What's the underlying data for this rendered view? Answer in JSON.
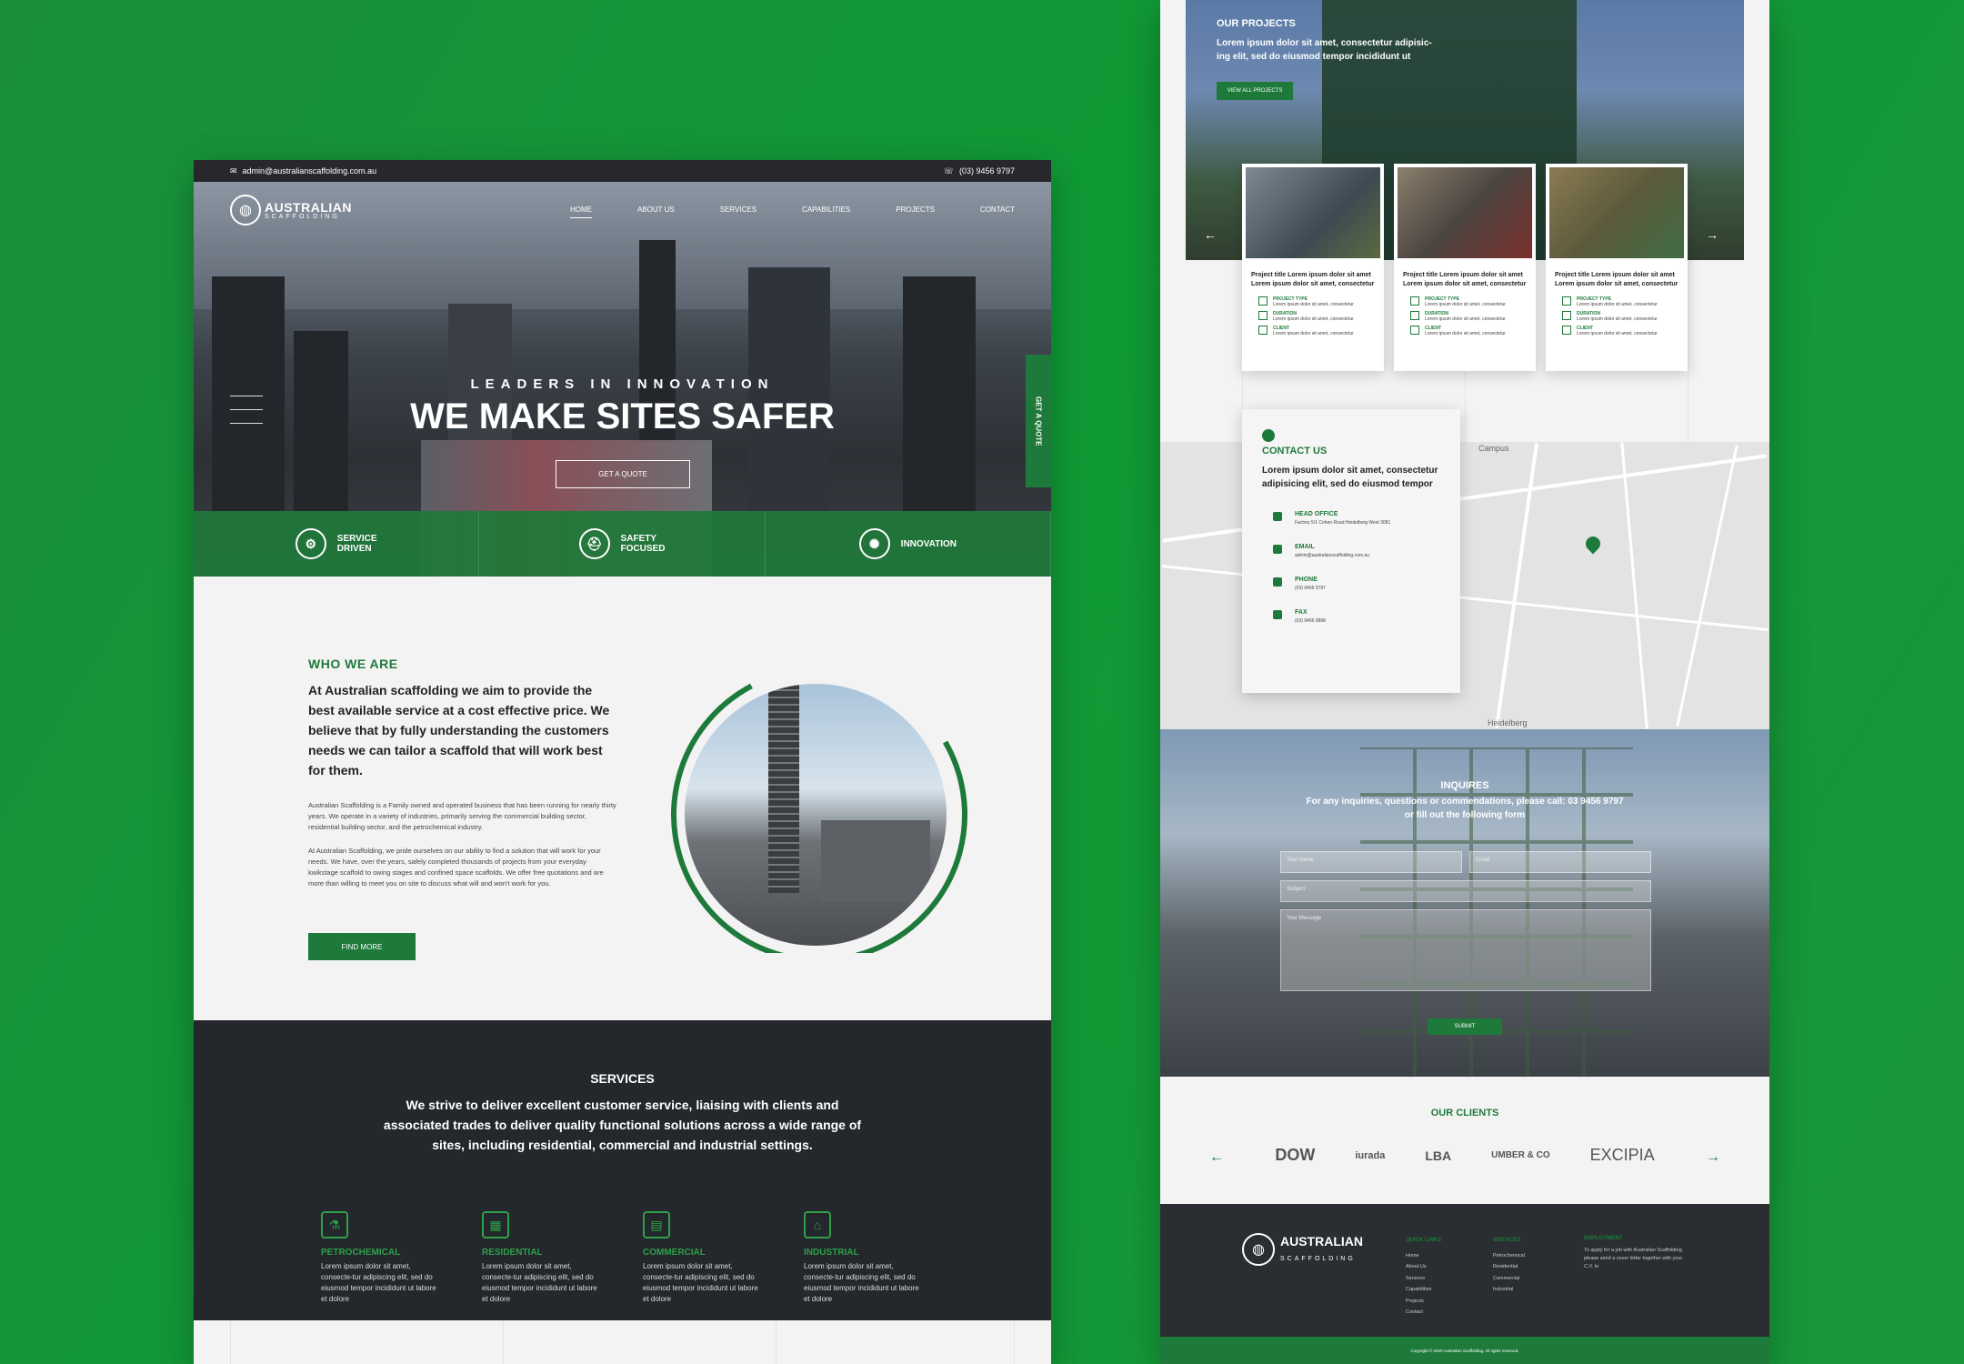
{
  "topbar": {
    "email": "admin@australianscaffolding.com.au",
    "phone": "(03) 9456 9797"
  },
  "brand": {
    "name": "AUSTRALIAN",
    "sub": "SCAFFOLDING"
  },
  "nav": [
    "HOME",
    "ABOUT US",
    "SERVICES",
    "CAPABILITIES",
    "PROJECTS",
    "CONTACT"
  ],
  "hero": {
    "tagline": "LEADERS IN INNOVATION",
    "title": "WE MAKE SITES SAFER",
    "button": "GET A QUOTE",
    "side_button": "GET A QUOTE"
  },
  "features": [
    {
      "label1": "SERVICE",
      "label2": "DRIVEN"
    },
    {
      "label1": "SAFETY",
      "label2": "FOCUSED"
    },
    {
      "label1": "INNOVATION",
      "label2": ""
    }
  ],
  "who": {
    "heading": "WHO WE ARE",
    "lead": "At Australian scaffolding we aim to provide the best available service at a cost effective price. We believe that by fully understanding the customers needs we can tailor a scaffold that will work best for them.",
    "p1": "Australian Scaffolding is a Family owned and operated business that has been running for nearly thirty years. We operate in a variety of industries, primarily serving the commercial building sector, residential building sector, and the petrochemical industry.",
    "p2": "At Australian Scaffolding, we pride ourselves on our ability to find a solution that will work for your needs. We have, over the years, safely completed thousands of projects from your everyday kwikstage scaffold to swing stages and confined space scaffolds. We offer free quotations and are more than willing to meet you on site to discuss what will and won't work for you.",
    "button": "FIND MORE"
  },
  "services": {
    "heading": "SERVICES",
    "sub": "We strive to deliver excellent customer service, liaising with clients and associated trades to deliver quality functional solutions across a wide range of sites, including residential, commercial and industrial settings.",
    "items": [
      {
        "title": "PETROCHEMICAL",
        "text": "Lorem ipsum dolor sit amet, consecte-tur adipiscing elit, sed do eiusmod tempor incididunt ut labore et dolore"
      },
      {
        "title": "RESIDENTIAL",
        "text": "Lorem ipsum dolor sit amet, consecte-tur adipiscing elit, sed do eiusmod tempor incididunt ut labore et dolore"
      },
      {
        "title": "COMMERCIAL",
        "text": "Lorem ipsum dolor sit amet, consecte-tur adipiscing elit, sed do eiusmod tempor incididunt ut labore et dolore"
      },
      {
        "title": "INDUSTRIAL",
        "text": "Lorem ipsum dolor sit amet, consecte-tur adipiscing elit, sed do eiusmod tempor incididunt ut labore et dolore"
      }
    ]
  },
  "projects": {
    "heading": "OUR PROJECTS",
    "lead": "Lorem ipsum dolor sit amet, consectetur adipisic-ing elit, sed do eiusmod tempor incididunt ut",
    "button": "VIEW ALL PROJECTS",
    "cards": [
      {
        "title": "Project title Lorem ipsum dolor sit amet Lorem ipsum dolor sit amet, consectetur",
        "type_label": "PROJECT TYPE",
        "type": "Lorem ipsum dolor sit amet, consectetur",
        "duration_label": "DURATION",
        "duration": "Lorem ipsum dolor sit amet, consectetur",
        "client_label": "CLIENT",
        "client": "Lorem ipsum dolor sit amet, consectetur"
      },
      {
        "title": "Project title Lorem ipsum dolor sit amet Lorem ipsum dolor sit amet, consectetur",
        "type_label": "PROJECT TYPE",
        "type": "Lorem ipsum dolor sit amet, consectetur",
        "duration_label": "DURATION",
        "duration": "Lorem ipsum dolor sit amet, consectetur",
        "client_label": "CLIENT",
        "client": "Lorem ipsum dolor sit amet, consectetur"
      },
      {
        "title": "Project title Lorem ipsum dolor sit amet Lorem ipsum dolor sit amet, consectetur",
        "type_label": "PROJECT TYPE",
        "type": "Lorem ipsum dolor sit amet, consectetur",
        "duration_label": "DURATION",
        "duration": "Lorem ipsum dolor sit amet, consectetur",
        "client_label": "CLIENT",
        "client": "Lorem ipsum dolor sit amet, consectetur"
      }
    ]
  },
  "contact": {
    "heading": "CONTACT US",
    "lead": "Lorem ipsum dolor sit amet, consectetur adipisicing elit, sed do eiusmod tempor",
    "items": [
      {
        "label": "HEAD OFFICE",
        "value": "Factory 5/1 Cohen Road Heidelberg West 3081"
      },
      {
        "label": "EMAIL",
        "value": "admin@australianscaffolding.com.au"
      },
      {
        "label": "PHONE",
        "value": "(03) 9456 9797"
      },
      {
        "label": "FAX",
        "value": "(03) 9456 9898"
      }
    ],
    "map_labels": [
      "Campus",
      "Heidelberg"
    ]
  },
  "inquiries": {
    "heading": "INQUIRES",
    "text": "For any inquiries, questions or commendations, please call: 03 9456 9797 or fill out the following form",
    "name_placeholder": "Your Name",
    "email_placeholder": "Email",
    "subject_placeholder": "Subject",
    "message_placeholder": "Your Message",
    "submit": "SUBMIT"
  },
  "clients": {
    "heading": "OUR CLIENTS",
    "logos": [
      "DOW",
      "iurada",
      "LBA",
      "UMBER & CO",
      "EXCIPIA"
    ]
  },
  "footer": {
    "brand": "AUSTRALIAN",
    "brand_sub": "SCAFFOLDING",
    "quick_heading": "QUICK LINKS",
    "quick": [
      "Home",
      "About Us",
      "Services",
      "Capabilities",
      "Projects",
      "Contact"
    ],
    "services_heading": "SERVICES",
    "services": [
      "Petrochemical",
      "Residential",
      "Commercial",
      "Industrial"
    ],
    "employment_heading": "EMPLOYMENT",
    "employment": "To apply for a job with Australian Scaffolding, please send a cover letter together with your C.V. to",
    "copyright": "Copyright © 2020 Australian Scaffolding. All rights reserved."
  },
  "colors": {
    "brand_green": "#1e7a3a",
    "dark": "#24272b",
    "background_green": "#129a37"
  }
}
